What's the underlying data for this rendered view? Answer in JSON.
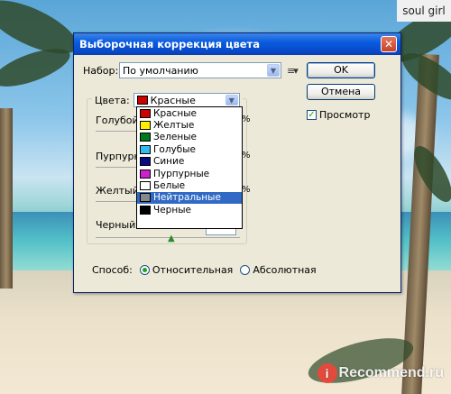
{
  "caption": "soul girl",
  "watermark": {
    "logo": "i",
    "text": "Recommend.ru"
  },
  "dialog": {
    "title": "Выборочная коррекция цвета",
    "preset": {
      "label": "Набор:",
      "value": "По умолчанию"
    },
    "buttons": {
      "ok": "OK",
      "cancel": "Отмена"
    },
    "preview": {
      "label": "Просмотр",
      "checked": true
    },
    "colors": {
      "label": "Цвета:",
      "value": "Красные",
      "swatch": "#cc0000"
    },
    "sliders": [
      {
        "label": "Голубой:"
      },
      {
        "label": "Пурпурные"
      },
      {
        "label": "Желтый:"
      },
      {
        "label": "Черный:"
      }
    ],
    "percent_sign": "%",
    "method": {
      "label": "Способ:",
      "options": [
        {
          "label": "Относительная",
          "selected": true
        },
        {
          "label": "Абсолютная",
          "selected": false
        }
      ]
    },
    "dropdown_items": [
      {
        "label": "Красные",
        "color": "#cc0000",
        "selected": false
      },
      {
        "label": "Желтые",
        "color": "#ffee00",
        "selected": false
      },
      {
        "label": "Зеленые",
        "color": "#007a1e",
        "selected": false
      },
      {
        "label": "Голубые",
        "color": "#33bbee",
        "selected": false
      },
      {
        "label": "Синие",
        "color": "#0a0a80",
        "selected": false
      },
      {
        "label": "Пурпурные",
        "color": "#cc22cc",
        "selected": false
      },
      {
        "label": "Белые",
        "color": "#ffffff",
        "selected": false
      },
      {
        "label": "Нейтральные",
        "color": "#888888",
        "selected": true
      },
      {
        "label": "Черные",
        "color": "#000000",
        "selected": false
      }
    ]
  }
}
